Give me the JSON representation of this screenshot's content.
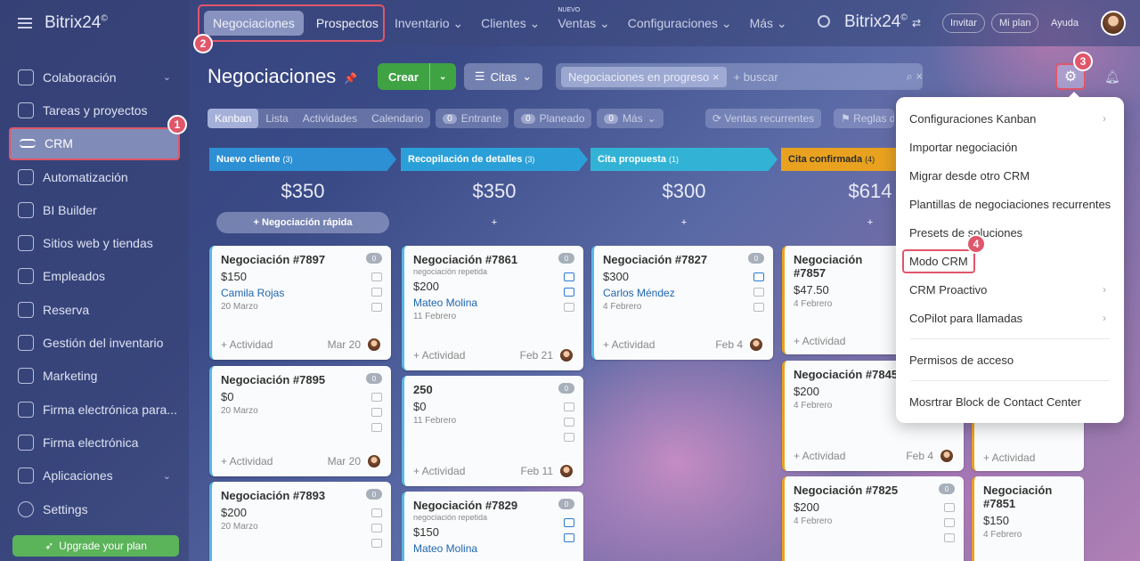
{
  "app": {
    "brand": "Bitrix24",
    "brand_mark": "©"
  },
  "sidebar": {
    "items": [
      {
        "label": "Colaboración",
        "chevron": true
      },
      {
        "label": "Tareas y proyectos",
        "chevron": false
      },
      {
        "label": "CRM",
        "chevron": false,
        "active": true
      },
      {
        "label": "Automatización",
        "chevron": false
      },
      {
        "label": "BI Builder",
        "chevron": false
      },
      {
        "label": "Sitios web y tiendas",
        "chevron": false
      },
      {
        "label": "Empleados",
        "chevron": false
      },
      {
        "label": "Reserva",
        "chevron": false
      },
      {
        "label": "Gestión del inventario",
        "chevron": false
      },
      {
        "label": "Marketing",
        "chevron": false
      },
      {
        "label": "Firma electrónica para...",
        "chevron": false
      },
      {
        "label": "Firma electrónica",
        "chevron": false
      },
      {
        "label": "Aplicaciones",
        "chevron": true
      },
      {
        "label": "Settings",
        "chevron": false
      }
    ],
    "upgrade_label": "Upgrade your plan"
  },
  "topbar": {
    "tabs": [
      "Negociaciones",
      "Prospectos"
    ],
    "menu": [
      "Inventario",
      "Clientes",
      "Ventas",
      "Configuraciones",
      "Más"
    ],
    "nuevo_badge": "NUEVO",
    "invite": "Invitar",
    "my_plan": "Mi plan",
    "help": "Ayuda"
  },
  "toolbar": {
    "title": "Negociaciones",
    "create": "Crear",
    "citas": "Citas",
    "filter_chip": "Negociaciones en progreso",
    "search_placeholder": "+ buscar"
  },
  "views": {
    "modes": [
      "Kanban",
      "Lista",
      "Actividades",
      "Calendario"
    ],
    "counters": [
      {
        "count": "0",
        "label": "Entrante"
      },
      {
        "count": "0",
        "label": "Planeado"
      },
      {
        "count": "0",
        "label": "Más"
      }
    ],
    "recurring": "Ventas recurrentes",
    "rules": "Reglas de"
  },
  "columns": [
    {
      "title": "Nuevo cliente",
      "count": "(3)",
      "sum": "$350",
      "add": "+ Negociación rápida",
      "color": "#2d8fd4"
    },
    {
      "title": "Recopilación de detalles",
      "count": "(3)",
      "sum": "$350",
      "add": "+",
      "color": "#2ba0d8"
    },
    {
      "title": "Cita propuesta",
      "count": "(1)",
      "sum": "$300",
      "add": "+",
      "color": "#32b3d6"
    },
    {
      "title": "Cita confirmada",
      "count": "(4)",
      "sum": "$614",
      "add": "+",
      "color": "#e8a21f"
    }
  ],
  "cards": [
    {
      "title": "Negociación #7897",
      "price": "$150",
      "contact": "Camila Rojas",
      "date": "20 Marzo",
      "activity": "+ Actividad",
      "foot_date": "Mar 20",
      "badge": "0"
    },
    {
      "title": "Negociación #7895",
      "price": "$0",
      "date": "20 Marzo",
      "activity": "+ Actividad",
      "foot_date": "Mar 20",
      "badge": "0"
    },
    {
      "title": "Negociación #7893",
      "price": "$200",
      "date": "20 Marzo",
      "badge": "0"
    },
    {
      "title": "Negociación #7861",
      "sub": "negociación repetida",
      "price": "$200",
      "contact": "Mateo Molina",
      "date": "11 Febrero",
      "activity": "+ Actividad",
      "foot_date": "Feb 21",
      "badge": "0"
    },
    {
      "title": "250",
      "price": "$0",
      "date": "11 Febrero",
      "activity": "+ Actividad",
      "foot_date": "Feb 11",
      "badge": "0"
    },
    {
      "title": "Negociación #7829",
      "sub": "negociación repetida",
      "price": "$150",
      "contact": "Mateo Molina",
      "badge": "0"
    },
    {
      "title": "Negociación #7827",
      "price": "$300",
      "contact": "Carlos Méndez",
      "date": "4 Febrero",
      "activity": "+ Actividad",
      "foot_date": "Feb 4",
      "badge": "0"
    },
    {
      "title": "Negociación #7857",
      "price": "$47.50",
      "date": "4 Febrero",
      "activity": "+ Actividad"
    },
    {
      "title": "Negociación #7845",
      "price": "$200",
      "date": "4 Febrero",
      "activity": "+ Actividad",
      "foot_date": "Feb 4"
    },
    {
      "title": "Negociación #7825",
      "price": "$200",
      "date": "4 Febrero",
      "badge": "0"
    },
    {
      "title": "Negociación #7851",
      "price": "$150",
      "date": "4 Febrero"
    },
    {
      "activity": "+ Actividad"
    }
  ],
  "dropdown": {
    "items": [
      {
        "label": "Configuraciones Kanban",
        "arrow": "›"
      },
      {
        "label": "Importar negociación"
      },
      {
        "label": "Migrar desde otro CRM"
      },
      {
        "label": "Plantillas de negociaciones recurrentes"
      },
      {
        "label": "Presets de soluciones"
      },
      {
        "label": "Modo CRM"
      },
      {
        "label": "CRM Proactivo",
        "arrow": "›"
      },
      {
        "label": "CoPilot para llamadas",
        "arrow": "›"
      },
      {
        "label": "Permisos de acceso"
      },
      {
        "label": "Mosrtrar Block de Contact Center"
      }
    ]
  },
  "markers": [
    "1",
    "2",
    "3",
    "4"
  ],
  "colors": {
    "highlight": "#e0566a",
    "create": "#3fa344",
    "link": "#2066b0"
  }
}
